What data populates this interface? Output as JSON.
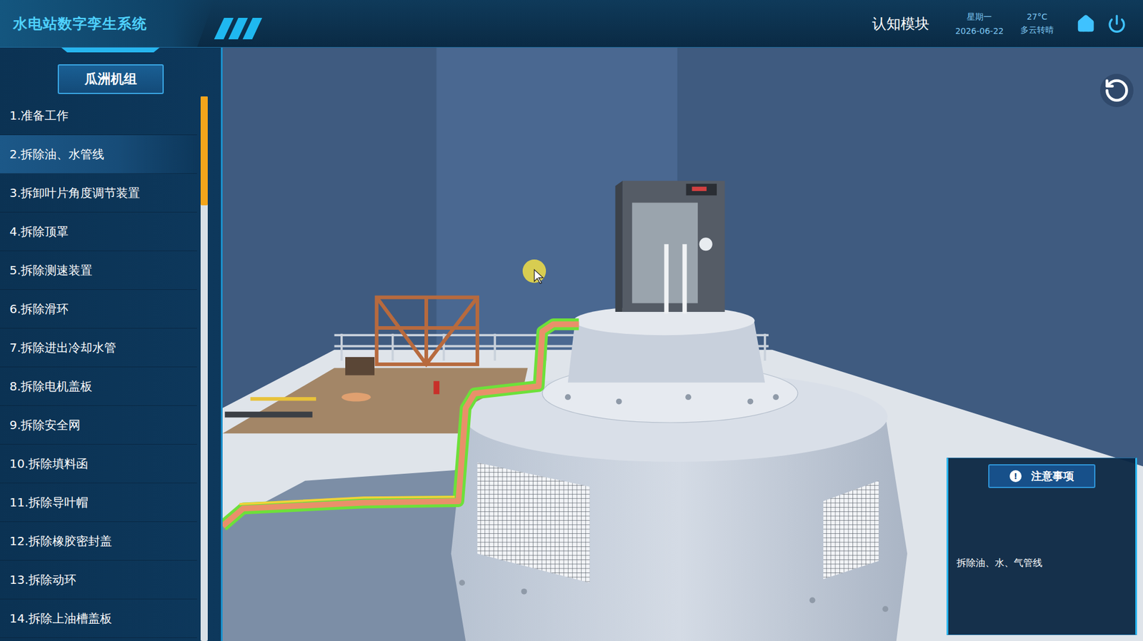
{
  "header": {
    "title": "水电站数字孪生系统",
    "module": "认知模块",
    "weekday": "星期一",
    "date": "2026-06-22",
    "temperature": "27°C",
    "weather": "多云转晴"
  },
  "sidebar": {
    "title": "瓜洲机组",
    "scroll_level": 0.2,
    "items": [
      {
        "label": "1.准备工作",
        "selected": false
      },
      {
        "label": "2.拆除油、水管线",
        "selected": true
      },
      {
        "label": "3.拆卸叶片角度调节装置",
        "selected": false
      },
      {
        "label": "4.拆除顶罩",
        "selected": false
      },
      {
        "label": "5.拆除测速装置",
        "selected": false
      },
      {
        "label": "6.拆除滑环",
        "selected": false
      },
      {
        "label": "7.拆除进出冷却水管",
        "selected": false
      },
      {
        "label": "8.拆除电机盖板",
        "selected": false
      },
      {
        "label": "9.拆除安全网",
        "selected": false
      },
      {
        "label": "10.拆除填料函",
        "selected": false
      },
      {
        "label": "11.拆除导叶帽",
        "selected": false
      },
      {
        "label": "12.拆除橡胶密封盖",
        "selected": false
      },
      {
        "label": "13.拆除动环",
        "selected": false
      },
      {
        "label": "14.拆除上油槽盖板",
        "selected": false
      }
    ]
  },
  "notice": {
    "icon": "!",
    "title": "注意事项",
    "text": "拆除油、水、气管线"
  }
}
